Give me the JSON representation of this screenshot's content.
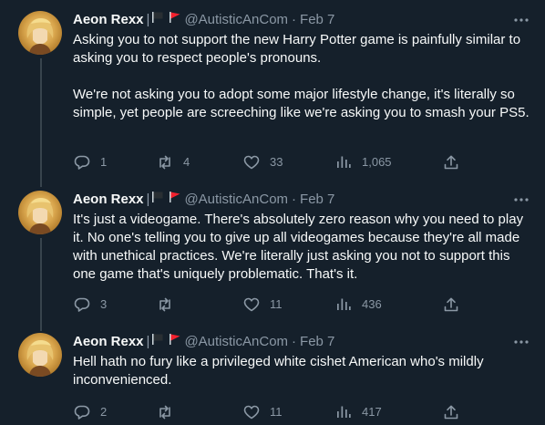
{
  "colors": {
    "background": "#15202b",
    "text_primary": "#f7f9f9",
    "text_secondary": "#8b98a5",
    "flag_red": "#f4212e"
  },
  "tweets": [
    {
      "author_name": "Aeon Rexx",
      "pipe": "|",
      "flags": [
        "black-flag",
        "red-flag"
      ],
      "handle": "@AutisticAnCom",
      "separator": "·",
      "date": "Feb 7",
      "paragraphs": [
        "Asking you to not support the new Harry Potter game is painfully similar to asking you to respect people's pronouns.",
        "We're not asking you to adopt some major lifestyle change, it's literally so simple, yet people are screeching like we're asking you to smash your PS5."
      ],
      "replies": "1",
      "retweets": "4",
      "likes": "33",
      "views": "1,065"
    },
    {
      "author_name": "Aeon Rexx",
      "pipe": "|",
      "flags": [
        "black-flag",
        "red-flag"
      ],
      "handle": "@AutisticAnCom",
      "separator": "·",
      "date": "Feb 7",
      "paragraphs": [
        "It's just a videogame. There's absolutely zero reason why you need to play it. No one's telling you to give up all videogames because they're all made with unethical practices. We're literally just asking you not to support this one game that's uniquely problematic. That's it."
      ],
      "replies": "3",
      "retweets": "",
      "likes": "11",
      "views": "436"
    },
    {
      "author_name": "Aeon Rexx",
      "pipe": "|",
      "flags": [
        "black-flag",
        "red-flag"
      ],
      "handle": "@AutisticAnCom",
      "separator": "·",
      "date": "Feb 7",
      "paragraphs": [
        "Hell hath no fury like a privileged white cishet American who's mildly inconvenienced."
      ],
      "replies": "2",
      "retweets": "",
      "likes": "11",
      "views": "417"
    }
  ]
}
